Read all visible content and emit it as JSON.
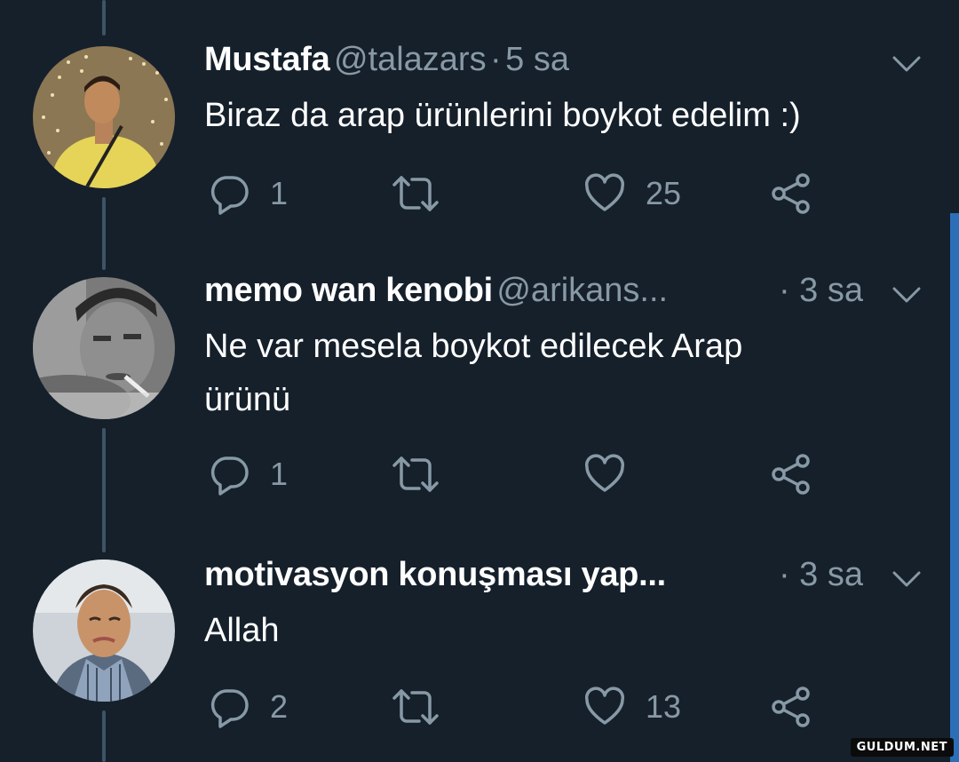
{
  "colors": {
    "background": "#15202b",
    "muted_text": "#8899a6",
    "thread_line": "#3d5466",
    "scrollbar": "#2b6fb8"
  },
  "tweets": [
    {
      "name": "Mustafa",
      "handle": "@talazars",
      "separator": "·",
      "time": "5 sa",
      "text": "Biraz da arap ürünlerini boykot edelim :)",
      "reply_count": "1",
      "retweet_count": "",
      "like_count": "25"
    },
    {
      "name": "memo wan kenobi",
      "handle": "@arikans...",
      "time": "· 3 sa",
      "text_line1": "Ne var mesela boykot edilecek Arap",
      "text_line2": "ürünü",
      "reply_count": "1",
      "retweet_count": "",
      "like_count": ""
    },
    {
      "name": "motivasyon konuşması yap...",
      "time": "· 3 sa",
      "text": "Allah",
      "reply_count": "2",
      "retweet_count": "",
      "like_count": "13"
    }
  ],
  "icons": {
    "reply": "reply-icon",
    "retweet": "retweet-icon",
    "like": "heart-icon",
    "share": "share-icon",
    "menu": "chevron-down-icon"
  },
  "watermark": "GULDUM.NET"
}
